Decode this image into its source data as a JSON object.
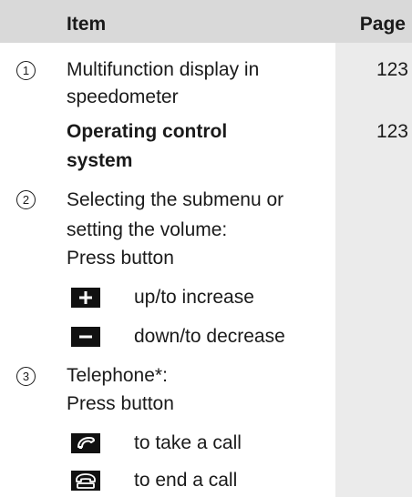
{
  "colors": {
    "header_bg": "#d9d9d9",
    "page_col_bg": "#ebebeb",
    "text": "#1a1a1a",
    "icon_bg": "#111111"
  },
  "header": {
    "item": "Item",
    "page": "Page"
  },
  "rows": [
    {
      "marker": "1",
      "lines": [
        "Multifunction display in",
        "speedometer"
      ],
      "page": "123"
    },
    {
      "lines": [
        "Operating control",
        "system"
      ],
      "page": "123",
      "bold": true
    },
    {
      "marker": "2",
      "lines": [
        "Selecting the submenu or",
        "setting the volume:",
        "Press button"
      ],
      "sub": [
        {
          "icon": "plus-icon",
          "text": "up/to increase"
        },
        {
          "icon": "minus-icon",
          "text": "down/to decrease"
        }
      ]
    },
    {
      "marker": "3",
      "lines": [
        "Telephone*:",
        "Press button"
      ],
      "sub": [
        {
          "icon": "phone-answer-icon",
          "text": "to take a call"
        },
        {
          "icon": "phone-end-icon",
          "text": "to end a call"
        }
      ]
    }
  ]
}
